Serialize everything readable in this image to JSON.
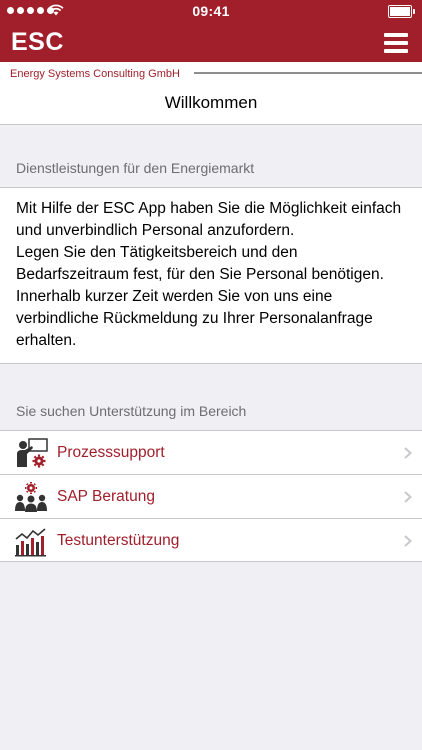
{
  "colors": {
    "brand": "#a01f2b",
    "chevron": "#c7c7cc",
    "icon_dark": "#333333"
  },
  "status_bar": {
    "time": "09:41"
  },
  "header": {
    "app_title": "ESC",
    "company": "Energy Systems Consulting GmbH",
    "menu_icon": "hamburger-menu-icon"
  },
  "nav": {
    "title": "Willkommen"
  },
  "services": {
    "header": "Dienstleistungen für den Energiemarkt",
    "text": "Mit Hilfe der ESC App haben Sie die Möglichkeit einfach und unverbindlich Personal anzufordern.\nLegen Sie den Tätigkeitsbereich und den Bedarfszeitraum fest, für den Sie Personal benötigen. Innerhalb kurzer Zeit werden Sie von uns eine verbindliche Rückmeldung zu Ihrer Personalanfrage erhalten."
  },
  "support": {
    "header": "Sie suchen Unterstützung im Bereich",
    "items": [
      {
        "label": "Prozesssupport",
        "icon": "presenter-gear-icon"
      },
      {
        "label": "SAP Beratung",
        "icon": "team-gear-icon"
      },
      {
        "label": "Testunterstützung",
        "icon": "bar-chart-icon"
      }
    ]
  }
}
